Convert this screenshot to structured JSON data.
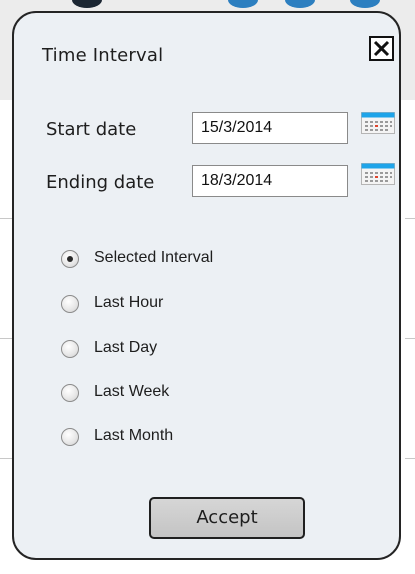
{
  "dialog": {
    "title": "Time Interval",
    "close_icon": "close-icon"
  },
  "start_date": {
    "label": "Start date",
    "value": "15/3/2014",
    "calendar_icon": "calendar-icon"
  },
  "ending_date": {
    "label": "Ending date",
    "value": "18/3/2014",
    "calendar_icon": "calendar-icon"
  },
  "interval_options": [
    {
      "label": "Selected Interval",
      "selected": true
    },
    {
      "label": "Last Hour",
      "selected": false
    },
    {
      "label": "Last Day",
      "selected": false
    },
    {
      "label": "Last Week",
      "selected": false
    },
    {
      "label": "Last Month",
      "selected": false
    }
  ],
  "accept_label": "Accept",
  "colors": {
    "dialog_background": "#ecf0f4",
    "dialog_border": "#242424",
    "button_background": "#c9c9c9",
    "calendar_header": "#1ea4e9",
    "calendar_highlight": "#e0442c"
  }
}
